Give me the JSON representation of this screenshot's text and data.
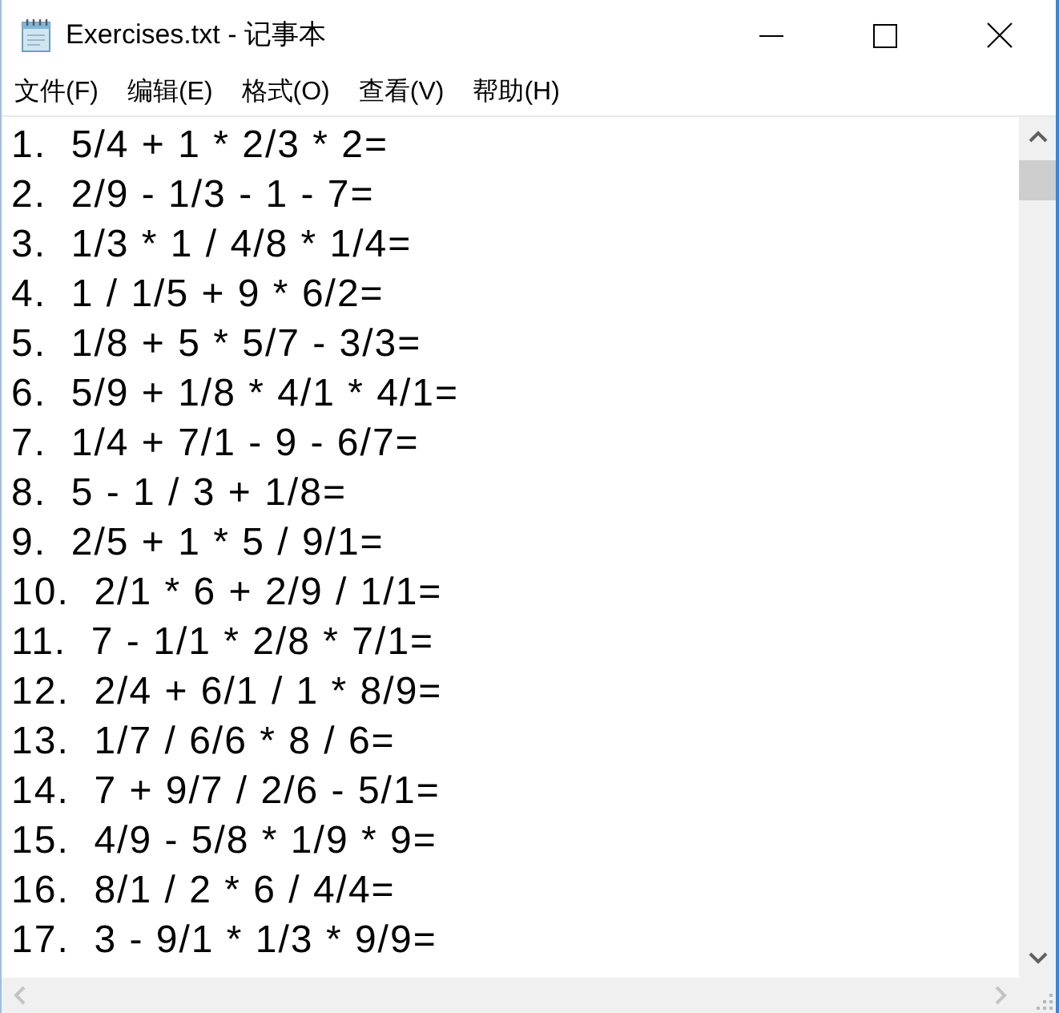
{
  "window": {
    "title": "Exercises.txt - 记事本"
  },
  "menu": [
    "文件(F)",
    "编辑(E)",
    "格式(O)",
    "查看(V)",
    "帮助(H)"
  ],
  "editor": {
    "lines": [
      "1.  5/4 + 1 * 2/3 * 2=",
      "2.  2/9 - 1/3 - 1 - 7=",
      "3.  1/3 * 1 / 4/8 * 1/4=",
      "4.  1 / 1/5 + 9 * 6/2=",
      "5.  1/8 + 5 * 5/7 - 3/3=",
      "6.  5/9 + 1/8 * 4/1 * 4/1=",
      "7.  1/4 + 7/1 - 9 - 6/7=",
      "8.  5 - 1 / 3 + 1/8=",
      "9.  2/5 + 1 * 5 / 9/1=",
      "10.  2/1 * 6 + 2/9 / 1/1=",
      "11.  7 - 1/1 * 2/8 * 7/1=",
      "12.  2/4 + 6/1 / 1 * 8/9=",
      "13.  1/7 / 6/6 * 8 / 6=",
      "14.  7 + 9/7 / 2/6 - 5/1=",
      "15.  4/9 - 5/8 * 1/9 * 9=",
      "16.  8/1 / 2 * 6 / 4/4=",
      "17.  3 - 9/1 * 1/3 * 9/9="
    ]
  }
}
